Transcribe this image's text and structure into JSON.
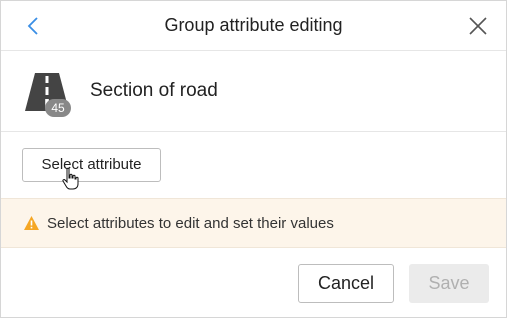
{
  "header": {
    "title": "Group attribute editing",
    "back_icon": "chevron-left-icon",
    "close_icon": "close-icon"
  },
  "object": {
    "icon": "road-section-icon",
    "count": "45",
    "name": "Section of road"
  },
  "select_attribute_button": {
    "label": "Select attribute"
  },
  "hint": {
    "icon": "warning-icon",
    "text": "Select attributes to edit and set their values"
  },
  "footer": {
    "cancel_label": "Cancel",
    "save_label": "Save",
    "save_enabled": false
  },
  "colors": {
    "accent_blue": "#3a8ee6",
    "warning_orange": "#f5a623",
    "hint_background": "#fdf5ea",
    "disabled_button": "#ebebeb"
  }
}
